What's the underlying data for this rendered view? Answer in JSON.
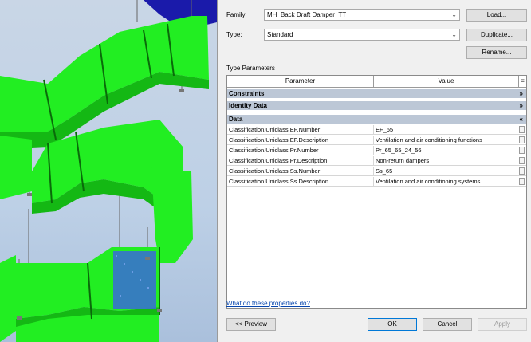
{
  "viewport": {
    "label": "3D view",
    "duct_color": "#22ee22",
    "background": "#bdd0e6"
  },
  "dialog": {
    "family_label": "Family:",
    "family_value": "MH_Back Draft Damper_TT",
    "type_label": "Type:",
    "type_value": "Standard",
    "load_button": "Load...",
    "duplicate_button": "Duplicate...",
    "rename_button": "Rename...",
    "type_parameters_label": "Type Parameters",
    "table": {
      "col_parameter": "Parameter",
      "col_value": "Value",
      "groups": [
        {
          "name": "Constraints",
          "chevron": "»"
        },
        {
          "name": "Identity Data",
          "chevron": "»"
        },
        {
          "name": "Data",
          "chevron": "«"
        }
      ],
      "rows": [
        {
          "parameter": "Classification.Uniclass.EF.Number",
          "value": "EF_65"
        },
        {
          "parameter": "Classification.Uniclass.EF.Description",
          "value": "Ventilation and air conditioning functions"
        },
        {
          "parameter": "Classification.Uniclass.Pr.Number",
          "value": "Pr_65_65_24_56"
        },
        {
          "parameter": "Classification.Uniclass.Pr.Description",
          "value": "Non-return dampers"
        },
        {
          "parameter": "Classification.Uniclass.Ss.Number",
          "value": "Ss_65"
        },
        {
          "parameter": "Classification.Uniclass.Ss.Description",
          "value": "Ventilation and air conditioning systems"
        }
      ]
    },
    "help_link": "What do these properties do?",
    "preview_button": "<< Preview",
    "ok_button": "OK",
    "cancel_button": "Cancel",
    "apply_button": "Apply"
  }
}
